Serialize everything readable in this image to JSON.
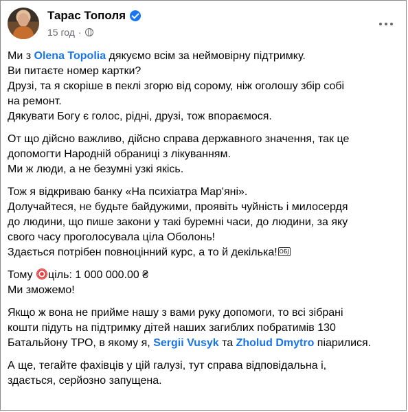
{
  "post": {
    "author": "Тарас Тополя",
    "time": "15 год",
    "separator": "·",
    "paragraphs": [
      {
        "lines": [
          [
            "Ми з ",
            {
              "mention": "Olena Topolia"
            },
            " дякуємо всім за неймовірну підтримку."
          ],
          [
            "Ви питаєте номер картки?"
          ],
          [
            "Друзі, та я скоріше в пеклі згорю від сорому, ніж оголошу збір собі"
          ],
          [
            "на ремонт."
          ],
          [
            "Дякувати Богу є голос, рідні, друзі, тож впораємося."
          ]
        ]
      },
      {
        "lines": [
          [
            "От що дійсно важливо, дійсно справа державного значення, так це"
          ],
          [
            "допомогти Народній обраниці з лікуванням."
          ],
          [
            "Ми ж люди, а не безумні узкі якісь."
          ]
        ]
      },
      {
        "lines": [
          [
            "Тож я відкриваю банку «На психіатра Мар'яні»."
          ],
          [
            "Долучайтеся, не будьте байдужими, проявіть чуйність і милосердя"
          ],
          [
            "до людини, що пише закони у такі буремні часи, до людини, за яку"
          ],
          [
            "свого часу проголосувала ціла Оболонь!"
          ],
          [
            "Здається потрібен повноцінний курс, а то й декілька!",
            {
              "icon": "ОБJ"
            }
          ]
        ]
      },
      {
        "lines": [
          [
            "Тому ",
            {
              "target": "target-icon"
            },
            "ціль: 1 000 000.00 ₴"
          ],
          [
            "Ми  зможемо!"
          ]
        ]
      },
      {
        "lines": [
          [
            "Якщо ж вона не прийме нашу з вами руку допомоги, то всі зібрані"
          ],
          [
            "кошти підуть на підтримку дітей наших загиблих побратимів 130"
          ],
          [
            "Батальйону ТРО, в якому я, ",
            {
              "mention": "Sergii Vusyk"
            },
            " та ",
            {
              "mention": "Zholud Dmytro"
            },
            " піарилися."
          ]
        ]
      },
      {
        "lines": [
          [
            "А ще, тегайте фахівців у цій галузі, тут справа відповідальна і,"
          ],
          [
            "здається, серйозно запущена."
          ]
        ]
      }
    ]
  },
  "colors": {
    "mention": "#1b74e4",
    "meta": "#65676b",
    "verified": "#1877f2"
  },
  "icons": {
    "verified": "verified-badge-icon",
    "audience": "globe-icon",
    "menu": "more-options-icon",
    "goal": "target-icon",
    "object_replacement": "ОБJ"
  }
}
